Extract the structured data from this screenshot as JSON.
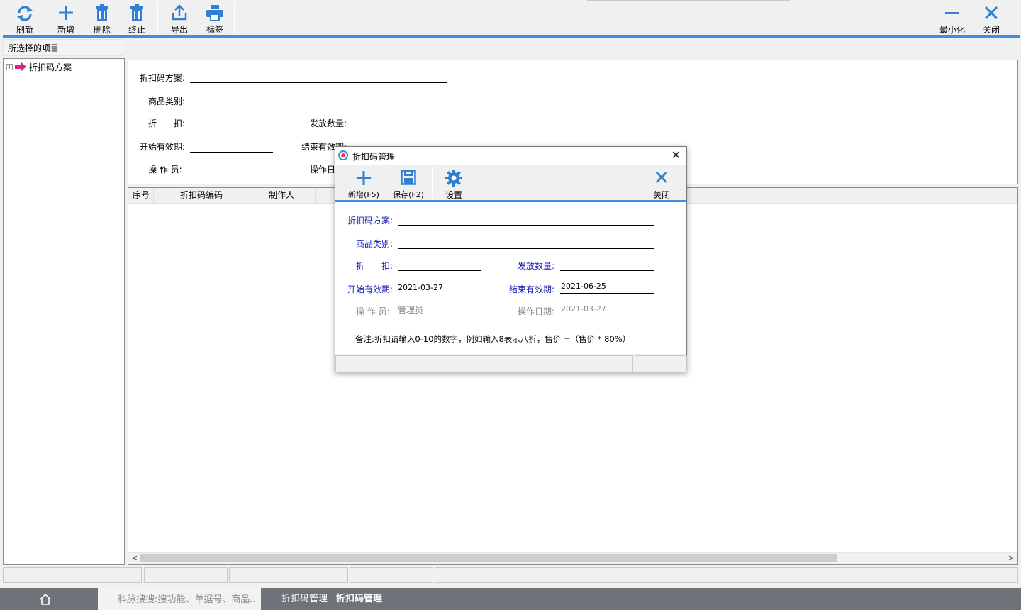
{
  "toolbar": {
    "refresh": "刷新",
    "add": "新增",
    "delete": "删除",
    "stop": "终止",
    "export": "导出",
    "label": "标签",
    "minimize": "最小化",
    "close": "关闭"
  },
  "left_panel": {
    "header": "所选择的项目",
    "tree_item": "折扣码方案"
  },
  "form": {
    "scheme": "折扣码方案:",
    "category": "商品类别:",
    "discount": "折　　扣:",
    "quantity": "发放数量:",
    "start_date": "开始有效期:",
    "end_date": "结束有效期:",
    "operator": "操 作 员:",
    "op_date": "操作日"
  },
  "grid": {
    "columns": [
      "序号",
      "折扣码编码",
      "制作人"
    ]
  },
  "dialog": {
    "title": "折扣码管理",
    "toolbar": {
      "add": "新增(F5)",
      "save": "保存(F2)",
      "settings": "设置",
      "close": "关闭"
    },
    "fields": {
      "scheme_label": "折扣码方案:",
      "category_label": "商品类别:",
      "discount_label": "折　　扣:",
      "quantity_label": "发放数量:",
      "start_label": "开始有效期:",
      "start_value": "2021-03-27",
      "end_label": "结束有效期:",
      "end_value": "2021-06-25",
      "operator_label": "操 作 员:",
      "operator_value": "管理员",
      "op_date_label": "操作日期:",
      "op_date_value": "2021-03-27"
    },
    "note": "备注:折扣请输入0-10的数字，例如输入8表示八折，售价 =（售价 * 80%）"
  },
  "taskbar": {
    "search_placeholder": "科脉搜搜:搜功能、单据号、商品...",
    "tab1": "折扣码管理",
    "tab2": "折扣码管理"
  },
  "colors": {
    "accent": "#3d8ee0",
    "label_blue": "#1c1cb8",
    "taskbar": "#6e7279"
  }
}
